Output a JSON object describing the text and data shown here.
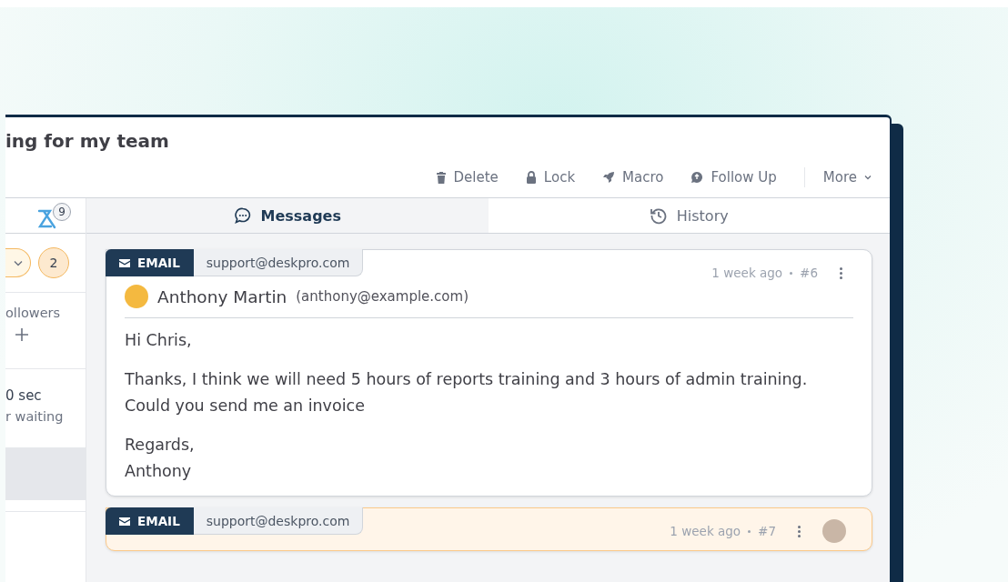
{
  "ticket": {
    "title": "ing for my team"
  },
  "toolbar": [
    {
      "kind": "delete",
      "label": "Delete"
    },
    {
      "kind": "lock",
      "label": "Lock"
    },
    {
      "kind": "macro",
      "label": "Macro"
    },
    {
      "kind": "followup",
      "label": "Follow Up"
    },
    {
      "kind": "more",
      "label": "More"
    }
  ],
  "sidebar": {
    "badge": "9",
    "count_badge": "2",
    "followers_label": "ollowers",
    "wait_time": "0 sec",
    "wait_label": "r waiting"
  },
  "tabs": [
    {
      "kind": "messages",
      "label": "Messages",
      "selected": true
    },
    {
      "kind": "history",
      "label": "History",
      "selected": false
    }
  ],
  "messages": [
    {
      "channel": "EMAIL",
      "address": "support@deskpro.com",
      "time": "1 week ago",
      "number": "#6",
      "highlighted": false,
      "sender_name": "Anthony Martin",
      "sender_email": "(anthony@example.com)",
      "body": [
        "Hi Chris,",
        "Thanks, I think we will need 5 hours of reports training and 3 hours of admin training.\nCould you send me an invoice",
        "Regards,\nAnthony"
      ]
    },
    {
      "channel": "EMAIL",
      "address": "support@deskpro.com",
      "time": "1 week ago",
      "number": "#7",
      "highlighted": true
    }
  ]
}
